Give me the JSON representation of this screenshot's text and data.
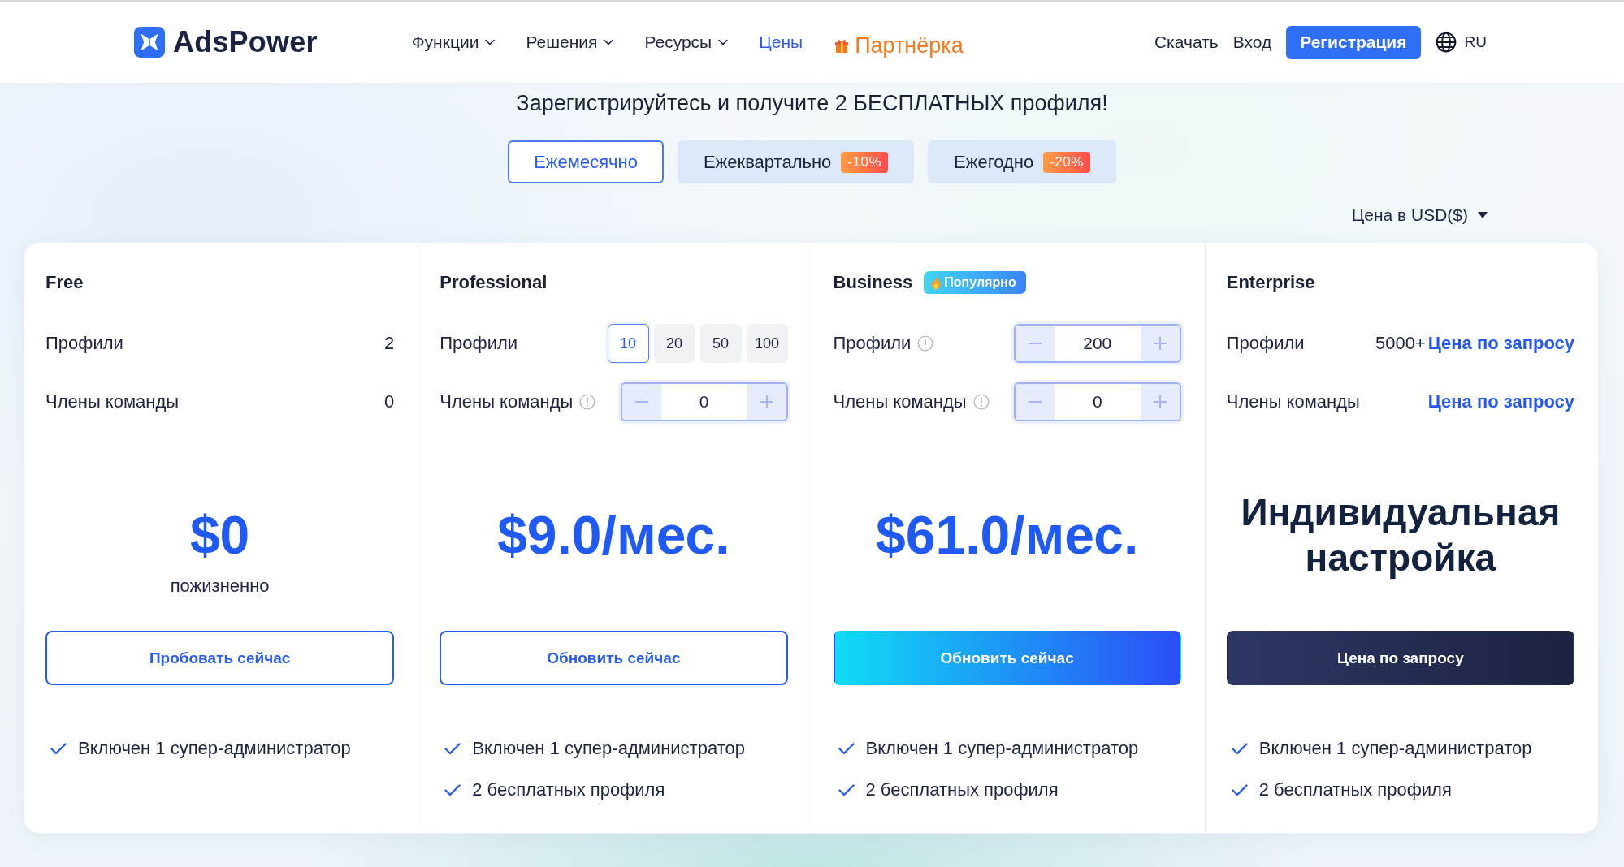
{
  "header": {
    "logo": "AdsPower",
    "nav": [
      {
        "label": "Функции",
        "kind": "dropdown",
        "selected": false
      },
      {
        "label": "Решения",
        "kind": "dropdown",
        "selected": false
      },
      {
        "label": "Ресурсы",
        "kind": "dropdown",
        "selected": false
      },
      {
        "label": "Цены",
        "kind": "link",
        "selected": true
      },
      {
        "label": "Партнёрка",
        "kind": "promo",
        "selected": false
      }
    ],
    "links": [
      "Скачать",
      "Вход"
    ],
    "register_button": "Регистрация",
    "language": "RU"
  },
  "promo_text": "Зарегистрируйтесь и получите 2 БЕСПЛАТНЫХ профиля!",
  "billing_tabs": [
    {
      "label": "Ежемесячно",
      "selected": true
    },
    {
      "label": "Ежеквартально",
      "discount": "-10%",
      "selected": false
    },
    {
      "label": "Ежегодно",
      "discount": "-20%",
      "selected": false
    }
  ],
  "currency": "Цена в USD($)",
  "plans": [
    {
      "name": "Free",
      "rows": [
        {
          "label": "Профили",
          "kind": "value",
          "info": false,
          "value": "2"
        },
        {
          "label": "Члены команды",
          "kind": "value",
          "info": false,
          "value": "0"
        }
      ],
      "price": {
        "kind": "amount",
        "text": "$0",
        "note": "пожизненно"
      },
      "button": {
        "label": "Пробовать сейчас",
        "kind": "outline"
      },
      "features": [
        "Включен 1 супер-администратор"
      ]
    },
    {
      "name": "Professional",
      "rows": [
        {
          "label": "Профили",
          "kind": "options",
          "info": false,
          "options": [
            {
              "label": "10",
              "selected": true
            },
            {
              "label": "20",
              "selected": false
            },
            {
              "label": "50",
              "selected": false
            },
            {
              "label": "100",
              "selected": false
            }
          ]
        },
        {
          "label": "Члены команды",
          "kind": "stepper",
          "info": true,
          "value": "0"
        }
      ],
      "price": {
        "kind": "amount",
        "text": "$9.0/мес."
      },
      "button": {
        "label": "Обновить сейчас",
        "kind": "outline"
      },
      "features": [
        "Включен 1 супер-администратор",
        "2 бесплатных профиля"
      ]
    },
    {
      "name": "Business",
      "badge": "Популярно",
      "rows": [
        {
          "label": "Профили",
          "kind": "stepper",
          "info": true,
          "value": "200"
        },
        {
          "label": "Члены команды",
          "kind": "stepper",
          "info": true,
          "value": "0"
        }
      ],
      "price": {
        "kind": "amount",
        "text": "$61.0/мес."
      },
      "button": {
        "label": "Обновить сейчас",
        "kind": "gradient"
      },
      "features": [
        "Включен 1 супер-администратор",
        "2 бесплатных профиля"
      ]
    },
    {
      "name": "Enterprise",
      "rows": [
        {
          "label": "Профили",
          "kind": "quote",
          "info": false,
          "value": "5000+",
          "link": "Цена по запросу"
        },
        {
          "label": "Члены команды",
          "kind": "quote",
          "info": false,
          "link": "Цена по запросу"
        }
      ],
      "price": {
        "kind": "custom",
        "text": "Индивидуальная настройка"
      },
      "button": {
        "label": "Цена по запросу",
        "kind": "dark"
      },
      "features": [
        "Включен 1 супер-администратор",
        "2 бесплатных профиля"
      ]
    }
  ]
}
